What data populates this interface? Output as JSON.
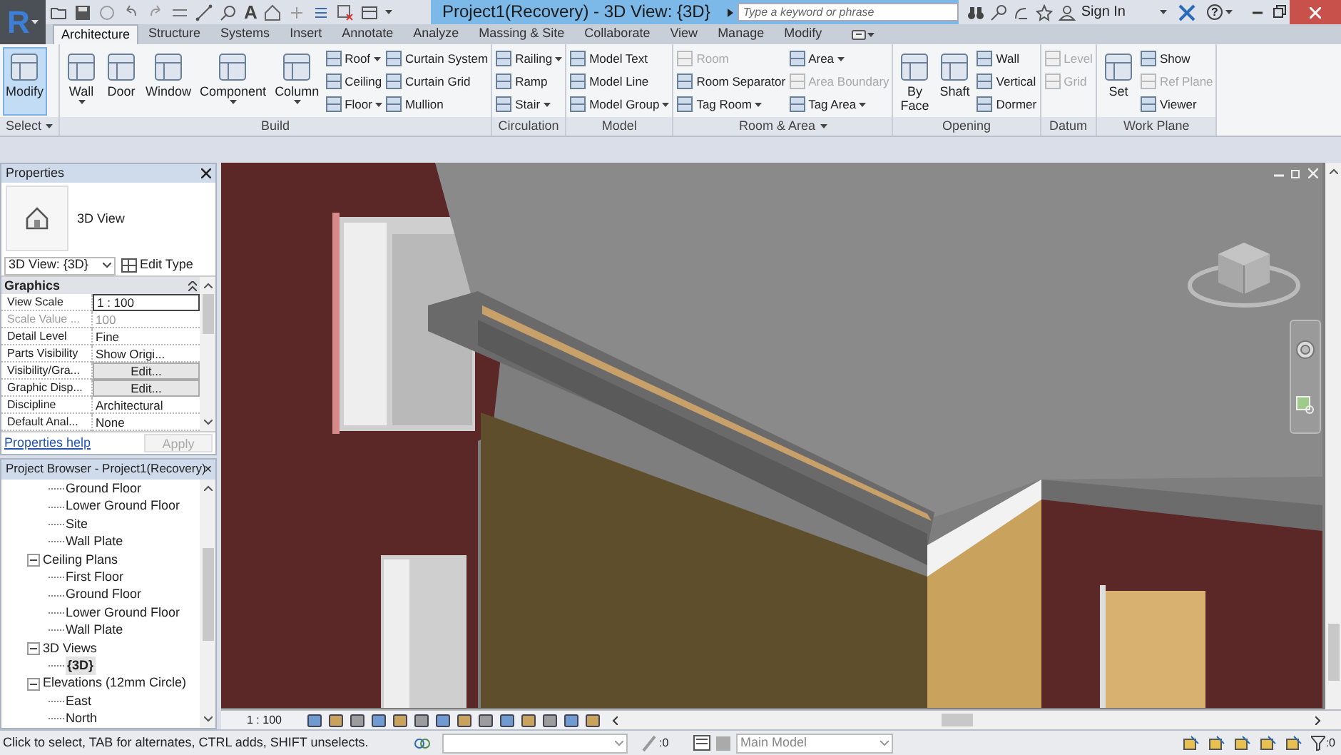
{
  "app_logo": "R",
  "quick_access": {
    "text_tool": "A"
  },
  "title": "Project1(Recovery) - 3D View: {3D}",
  "search": {
    "placeholder": "Type a keyword or phrase"
  },
  "sign_in": "Sign In",
  "help": "?",
  "tabs": [
    {
      "label": "Architecture",
      "selected": true
    },
    {
      "label": "Structure",
      "selected": false
    },
    {
      "label": "Systems",
      "selected": false
    },
    {
      "label": "Insert",
      "selected": false
    },
    {
      "label": "Annotate",
      "selected": false
    },
    {
      "label": "Analyze",
      "selected": false
    },
    {
      "label": "Massing & Site",
      "selected": false
    },
    {
      "label": "Collaborate",
      "selected": false
    },
    {
      "label": "View",
      "selected": false
    },
    {
      "label": "Manage",
      "selected": false
    },
    {
      "label": "Modify",
      "selected": false
    }
  ],
  "ribbon_panels": [
    {
      "title": "Select",
      "menu": true,
      "columns": [
        {
          "kind": "large",
          "label": "Modify",
          "selected": true,
          "dropdown": false
        }
      ]
    },
    {
      "title": "Build",
      "menu": false,
      "columns": [
        {
          "kind": "large",
          "label": "Wall",
          "selected": false,
          "dropdown": true
        },
        {
          "kind": "large",
          "label": "Door",
          "selected": false,
          "dropdown": false
        },
        {
          "kind": "large",
          "label": "Window",
          "selected": false,
          "dropdown": false
        },
        {
          "kind": "large",
          "label": "Component",
          "selected": false,
          "dropdown": true
        },
        {
          "kind": "large",
          "label": "Column",
          "selected": false,
          "dropdown": true
        },
        {
          "kind": "stack",
          "items": [
            {
              "label": "Roof",
              "dropdown": true,
              "disabled": false
            },
            {
              "label": "Ceiling",
              "dropdown": false,
              "disabled": false
            },
            {
              "label": "Floor",
              "dropdown": true,
              "disabled": false
            }
          ]
        },
        {
          "kind": "stack",
          "items": [
            {
              "label": "Curtain System",
              "dropdown": false,
              "disabled": false
            },
            {
              "label": "Curtain Grid",
              "dropdown": false,
              "disabled": false
            },
            {
              "label": "Mullion",
              "dropdown": false,
              "disabled": false
            }
          ]
        }
      ]
    },
    {
      "title": "Circulation",
      "menu": false,
      "columns": [
        {
          "kind": "stack",
          "items": [
            {
              "label": "Railing",
              "dropdown": true,
              "disabled": false
            },
            {
              "label": "Ramp",
              "dropdown": false,
              "disabled": false
            },
            {
              "label": "Stair",
              "dropdown": true,
              "disabled": false
            }
          ]
        }
      ]
    },
    {
      "title": "Model",
      "menu": false,
      "columns": [
        {
          "kind": "stack",
          "items": [
            {
              "label": "Model Text",
              "dropdown": false,
              "disabled": false
            },
            {
              "label": "Model Line",
              "dropdown": false,
              "disabled": false
            },
            {
              "label": "Model Group",
              "dropdown": true,
              "disabled": false
            }
          ]
        }
      ]
    },
    {
      "title": "Room & Area",
      "menu": true,
      "columns": [
        {
          "kind": "stack",
          "items": [
            {
              "label": "Room",
              "dropdown": false,
              "disabled": true
            },
            {
              "label": "Room Separator",
              "dropdown": false,
              "disabled": false
            },
            {
              "label": "Tag Room",
              "dropdown": true,
              "disabled": false
            }
          ]
        },
        {
          "kind": "stack",
          "items": [
            {
              "label": "Area",
              "dropdown": true,
              "disabled": false
            },
            {
              "label": "Area Boundary",
              "dropdown": false,
              "disabled": true
            },
            {
              "label": "Tag Area",
              "dropdown": true,
              "disabled": false
            }
          ]
        }
      ]
    },
    {
      "title": "Opening",
      "menu": false,
      "columns": [
        {
          "kind": "large",
          "label": "By\nFace",
          "selected": false,
          "dropdown": false
        },
        {
          "kind": "large",
          "label": "Shaft",
          "selected": false,
          "dropdown": false
        },
        {
          "kind": "stack",
          "items": [
            {
              "label": "Wall",
              "dropdown": false,
              "disabled": false
            },
            {
              "label": "Vertical",
              "dropdown": false,
              "disabled": false
            },
            {
              "label": "Dormer",
              "dropdown": false,
              "disabled": false
            }
          ]
        }
      ]
    },
    {
      "title": "Datum",
      "menu": false,
      "columns": [
        {
          "kind": "stack",
          "items": [
            {
              "label": "Level",
              "dropdown": false,
              "disabled": true
            },
            {
              "label": "Grid",
              "dropdown": false,
              "disabled": true
            }
          ]
        }
      ]
    },
    {
      "title": "Work Plane",
      "menu": false,
      "columns": [
        {
          "kind": "large",
          "label": "Set",
          "selected": false,
          "dropdown": false
        },
        {
          "kind": "stack",
          "items": [
            {
              "label": "Show",
              "dropdown": false,
              "disabled": false
            },
            {
              "label": "Ref Plane",
              "dropdown": false,
              "disabled": true
            },
            {
              "label": "Viewer",
              "dropdown": false,
              "disabled": false
            }
          ]
        }
      ]
    }
  ],
  "properties": {
    "title": "Properties",
    "type_name": "3D View",
    "selector": "3D View: {3D}",
    "edit_type": "Edit Type",
    "section": {
      "title": "Graphics",
      "expanded": true
    },
    "rows": [
      {
        "name": "View Scale",
        "value": "1 : 100",
        "kind": "field",
        "disabled": false
      },
      {
        "name": "Scale Value ...",
        "value": "100",
        "kind": "text",
        "disabled": true
      },
      {
        "name": "Detail Level",
        "value": "Fine",
        "kind": "text",
        "disabled": false
      },
      {
        "name": "Parts Visibility",
        "value": "Show Origi...",
        "kind": "text",
        "disabled": false
      },
      {
        "name": "Visibility/Gra...",
        "value": "Edit...",
        "kind": "button",
        "disabled": false
      },
      {
        "name": "Graphic Disp...",
        "value": "Edit...",
        "kind": "button",
        "disabled": false
      },
      {
        "name": "Discipline",
        "value": "Architectural",
        "kind": "text",
        "disabled": false
      },
      {
        "name": "Default Anal...",
        "value": "None",
        "kind": "text",
        "disabled": false
      }
    ],
    "help_link": "Properties help",
    "apply": {
      "label": "Apply",
      "disabled": true
    }
  },
  "project_browser": {
    "title": "Project Browser - Project1(Recovery)",
    "tree": [
      {
        "children": [
          {
            "label": "Ground Floor",
            "selected": false
          },
          {
            "label": "Lower Ground Floor",
            "selected": false
          },
          {
            "label": "Site",
            "selected": false
          },
          {
            "label": "Wall Plate",
            "selected": false
          }
        ]
      },
      {
        "label": "Ceiling Plans",
        "expanded": true,
        "selected": false,
        "children": [
          {
            "label": "First Floor",
            "selected": false
          },
          {
            "label": "Ground Floor",
            "selected": false
          },
          {
            "label": "Lower Ground Floor",
            "selected": false
          },
          {
            "label": "Wall Plate",
            "selected": false
          }
        ]
      },
      {
        "label": "3D Views",
        "expanded": true,
        "selected": false,
        "children": [
          {
            "label": "{3D}",
            "selected": true
          }
        ]
      },
      {
        "label": "Elevations (12mm Circle)",
        "expanded": true,
        "selected": false,
        "children": [
          {
            "label": "East",
            "selected": false
          },
          {
            "label": "North",
            "selected": false
          }
        ]
      }
    ]
  },
  "view_bar": {
    "scale": "1 : 100"
  },
  "status_bar": {
    "message": "Click to select, TAB for alternates, CTRL adds, SHIFT unselects.",
    "selection_count": ":0",
    "design_option": "Main Model",
    "filter_count": ":0"
  }
}
